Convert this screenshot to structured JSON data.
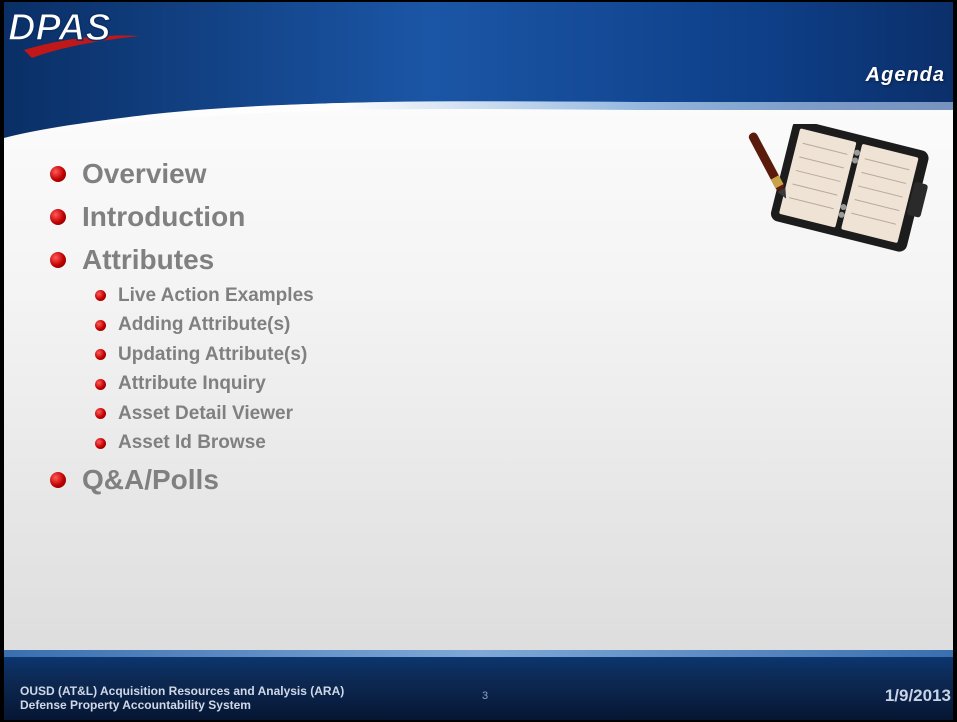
{
  "header": {
    "logo_text": "DPAS",
    "section_title": "Agenda"
  },
  "agenda": {
    "items": [
      {
        "label": "Overview",
        "level": 1
      },
      {
        "label": "Introduction",
        "level": 1
      },
      {
        "label": "Attributes",
        "level": 1
      },
      {
        "label": "Live Action Examples",
        "level": 2
      },
      {
        "label": "Adding Attribute(s)",
        "level": 2
      },
      {
        "label": "Updating Attribute(s)",
        "level": 2
      },
      {
        "label": "Attribute Inquiry",
        "level": 2
      },
      {
        "label": "Asset Detail Viewer",
        "level": 2
      },
      {
        "label": "Asset Id Browse",
        "level": 2
      },
      {
        "label": "Q&A/Polls",
        "level": 1
      }
    ]
  },
  "footer": {
    "org_line1": "OUSD (AT&L) Acquisition Resources and Analysis (ARA)",
    "org_line2": "Defense Property Accountability System",
    "page_number": "3",
    "date": "1/9/2013"
  },
  "colors": {
    "header_blue": "#0d3f82",
    "bullet_red": "#c00000",
    "text_gray": "#808080",
    "footer_blue": "#0b2d5e"
  },
  "icons": {
    "bullet": "red-sphere-bullet",
    "illustration": "planner-with-pen-icon"
  }
}
